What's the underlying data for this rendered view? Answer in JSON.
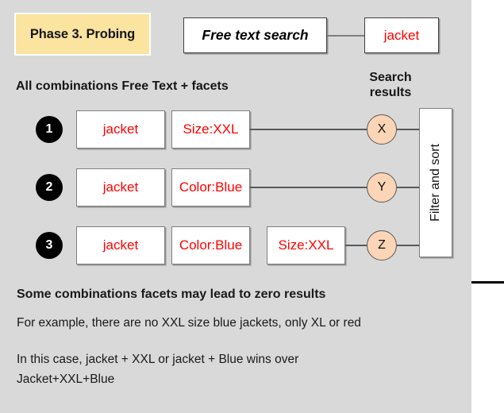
{
  "phase": {
    "label": "Phase 3. Probing"
  },
  "header": {
    "free_text_label": "Free text search",
    "free_text_value": "jacket"
  },
  "sections": {
    "combinations_heading": "All combinations Free Text + facets",
    "search_results_heading_line1": "Search",
    "search_results_heading_line2": "results"
  },
  "filter_panel": {
    "label": "Filter and sort"
  },
  "rows": [
    {
      "number": "1",
      "boxes": [
        "jacket",
        "Size:XXL"
      ],
      "result": "X"
    },
    {
      "number": "2",
      "boxes": [
        "jacket",
        "Color:Blue"
      ],
      "result": "Y"
    },
    {
      "number": "3",
      "boxes": [
        "jacket",
        "Color:Blue",
        "Size:XXL"
      ],
      "result": "Z"
    }
  ],
  "notes": [
    "Some combinations facets may lead to zero results",
    "For example, there are no XXL size blue jackets, only XL or red",
    "In this case, jacket + XXL or jacket + Blue wins over Jacket+XXL+Blue"
  ],
  "colors": {
    "panel_background": "#d9d9d9",
    "phase_banner": "#fbe3a0",
    "facet_text": "#ff0000",
    "result_circle": "#fbd5b5",
    "marker": "#000000"
  }
}
